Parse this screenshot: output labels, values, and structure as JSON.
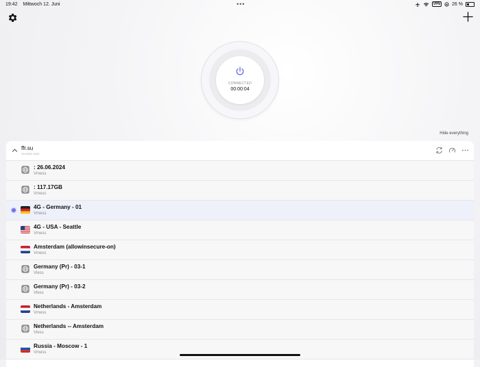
{
  "status_bar": {
    "time": "19:42",
    "date": "Mittwoch 12. Juni",
    "vpn_badge": "VPN",
    "battery": "26 %"
  },
  "top_bar": {
    "settings_icon": "gear-icon",
    "add_icon": "plus-icon"
  },
  "connection": {
    "icon": "power-icon",
    "status": "CONNECTED",
    "timer": "00:00:04",
    "accent": "#6f72e6"
  },
  "hide_everything": "Hide everything",
  "group": {
    "name": "ffr.su",
    "date": "12.6.2024, 19:42",
    "icons": [
      "refresh-icon",
      "speed-test-icon",
      "more-icon"
    ]
  },
  "servers": [
    {
      "title": ": 26.06.2024",
      "protocol": "Vmess",
      "flag": "globe",
      "selected": false
    },
    {
      "title": ": 117.17GB",
      "protocol": "Vmess",
      "flag": "globe",
      "selected": false
    },
    {
      "title": "4G - Germany - 01",
      "protocol": "Vmess",
      "flag": "de",
      "selected": true
    },
    {
      "title": "4G - USA - Seattle",
      "protocol": "Vmess",
      "flag": "us",
      "selected": false
    },
    {
      "title": "Amsterdam (allowinsecure-on)",
      "protocol": "Vmess",
      "flag": "nl",
      "selected": false
    },
    {
      "title": "Germany (Pr) - 03-1",
      "protocol": "Vless",
      "flag": "globe",
      "selected": false
    },
    {
      "title": "Germany (Pr) - 03-2",
      "protocol": "Vless",
      "flag": "globe",
      "selected": false
    },
    {
      "title": "Netherlands - Amsterdam",
      "protocol": "Vmess",
      "flag": "nl",
      "selected": false
    },
    {
      "title": "Netherlands -- Amsterdam",
      "protocol": "Vless",
      "flag": "globe",
      "selected": false
    },
    {
      "title": "Russia - Moscow - 1",
      "protocol": "Vmess",
      "flag": "ru",
      "selected": false
    }
  ]
}
